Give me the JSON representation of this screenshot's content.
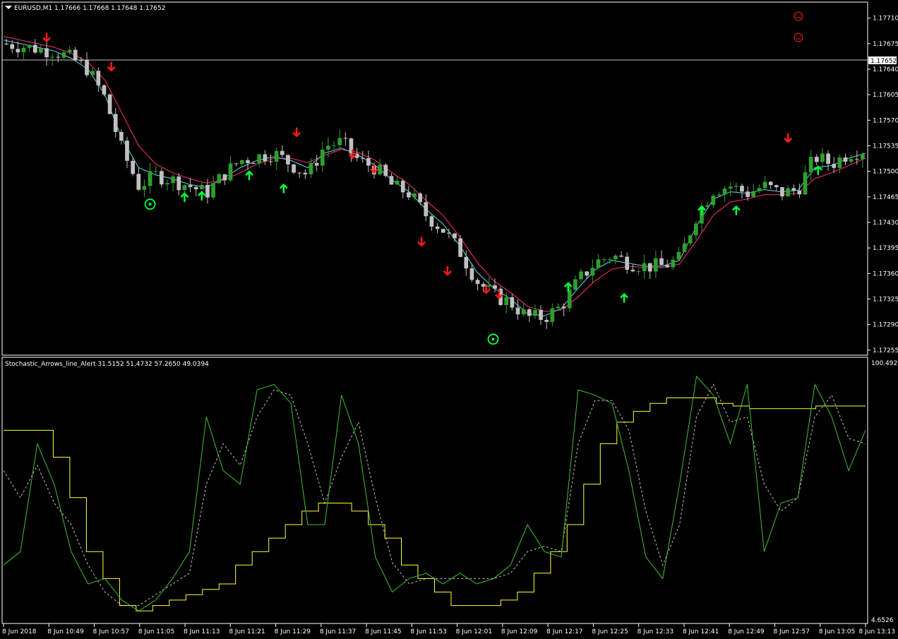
{
  "window": {
    "symbol_title": "EURUSD,M1",
    "ohlc": "1.17666 1.17668 1.17648 1.17652",
    "bid_label": "1.17652"
  },
  "indicator": {
    "title": "Stochastic_Arrows_line_Alert 31.5152 51.4732 57.2650 49.0394",
    "scale_max": "100.4927",
    "scale_min": "4.6526"
  },
  "colors": {
    "background": "#000000",
    "axis": "#ffffff",
    "bull_candle": "#2f9e2f",
    "bear_candle": "#c0c0c0",
    "ma_fast": "#5fd7e6",
    "ma_slow": "#ff2f6e",
    "buy_arrow": "#00ff3c",
    "sell_arrow": "#ff1a1a",
    "stoch_main": "#3fbf2f",
    "stoch_signal": "#c0c0c0",
    "stoch_yellow": "#ffff33",
    "face_icon": "#d42020"
  },
  "chart_data": [
    {
      "type": "candlestick",
      "title": "EURUSD,M1",
      "y_ticks": [
        "1.17710",
        "1.17675",
        "1.17640",
        "1.17605",
        "1.17570",
        "1.17535",
        "1.17500",
        "1.17465",
        "1.17430",
        "1.17395",
        "1.17360",
        "1.17325",
        "1.17290",
        "1.17255"
      ],
      "ylim": [
        1.1725,
        1.1773
      ],
      "bid_price": 1.17652,
      "x_ticks": [
        "8 Jun 2018",
        "8 Jun 10:49",
        "8 Jun 10:57",
        "8 Jun 11:05",
        "8 Jun 11:13",
        "8 Jun 11:21",
        "8 Jun 11:29",
        "8 Jun 11:37",
        "8 Jun 11:45",
        "8 Jun 11:53",
        "8 Jun 12:01",
        "8 Jun 12:09",
        "8 Jun 12:17",
        "8 Jun 12:25",
        "8 Jun 12:33",
        "8 Jun 12:41",
        "8 Jun 12:49",
        "8 Jun 12:57",
        "8 Jun 13:05",
        "8 Jun 13:13"
      ],
      "close_path": [
        1.17675,
        1.17672,
        1.17668,
        1.17665,
        1.17655,
        1.1764,
        1.176,
        1.1753,
        1.1748,
        1.17495,
        1.17488,
        1.1748,
        1.1747,
        1.17495,
        1.17515,
        1.1752,
        1.17525,
        1.1751,
        1.17495,
        1.17535,
        1.1754,
        1.17515,
        1.17505,
        1.1748,
        1.1747,
        1.1744,
        1.1742,
        1.1739,
        1.1735,
        1.1733,
        1.1732,
        1.173,
        1.173,
        1.17315,
        1.1735,
        1.17375,
        1.17385,
        1.17375,
        1.1737,
        1.1737,
        1.1738,
        1.1744,
        1.17475,
        1.1748,
        1.1747,
        1.1748,
        1.1747,
        1.17475,
        1.1752,
        1.1751,
        1.17525,
        1.1753
      ],
      "ma_fast": [
        1.1768,
        1.17675,
        1.1767,
        1.17665,
        1.17655,
        1.1764,
        1.17605,
        1.17545,
        1.17505,
        1.17495,
        1.1749,
        1.17482,
        1.17478,
        1.1749,
        1.17505,
        1.17515,
        1.1752,
        1.17515,
        1.17505,
        1.17525,
        1.17532,
        1.17522,
        1.17508,
        1.17488,
        1.17472,
        1.17448,
        1.17428,
        1.17398,
        1.17362,
        1.1734,
        1.17325,
        1.17305,
        1.17302,
        1.17312,
        1.1734,
        1.17365,
        1.17378,
        1.17374,
        1.1737,
        1.1737,
        1.17378,
        1.17425,
        1.17462,
        1.17472,
        1.1747,
        1.17475,
        1.17472,
        1.17474,
        1.17505,
        1.17508,
        1.17518,
        1.17525
      ],
      "ma_slow": [
        1.17685,
        1.1768,
        1.17675,
        1.1767,
        1.17662,
        1.1765,
        1.17625,
        1.1758,
        1.17535,
        1.1751,
        1.17498,
        1.1749,
        1.17484,
        1.17488,
        1.17498,
        1.1751,
        1.17518,
        1.17518,
        1.17512,
        1.17522,
        1.1753,
        1.17526,
        1.17515,
        1.17498,
        1.17482,
        1.1746,
        1.1744,
        1.1741,
        1.17376,
        1.1735,
        1.17334,
        1.17315,
        1.17308,
        1.1731,
        1.17328,
        1.1735,
        1.17366,
        1.1737,
        1.17368,
        1.17368,
        1.17373,
        1.17405,
        1.1744,
        1.17458,
        1.17462,
        1.17468,
        1.17468,
        1.1747,
        1.1749,
        1.17498,
        1.17508,
        1.17518
      ],
      "buy_arrows": [
        {
          "x": 0.21,
          "y": 1.17458
        },
        {
          "x": 0.23,
          "y": 1.1746
        },
        {
          "x": 0.285,
          "y": 1.17488
        },
        {
          "x": 0.325,
          "y": 1.1747
        },
        {
          "x": 0.655,
          "y": 1.17335
        },
        {
          "x": 0.72,
          "y": 1.1732
        },
        {
          "x": 0.81,
          "y": 1.1744
        },
        {
          "x": 0.85,
          "y": 1.1744
        },
        {
          "x": 0.945,
          "y": 1.17495
        }
      ],
      "sell_arrows": [
        {
          "x": 0.05,
          "y": 1.1769
        },
        {
          "x": 0.125,
          "y": 1.1765
        },
        {
          "x": 0.34,
          "y": 1.1756
        },
        {
          "x": 0.405,
          "y": 1.1753
        },
        {
          "x": 0.43,
          "y": 1.1751
        },
        {
          "x": 0.485,
          "y": 1.1741
        },
        {
          "x": 0.515,
          "y": 1.1737
        },
        {
          "x": 0.56,
          "y": 1.17345
        },
        {
          "x": 0.575,
          "y": 1.17338
        },
        {
          "x": 0.91,
          "y": 1.17552
        }
      ],
      "circle_markers": [
        {
          "x": 0.17,
          "y": 1.17455
        },
        {
          "x": 0.568,
          "y": 1.1727
        }
      ]
    },
    {
      "type": "line",
      "title": "Stochastic_Arrows_line_Alert",
      "ylim": [
        4.6526,
        100.4927
      ],
      "series": [
        {
          "name": "main",
          "values": [
            25,
            30,
            70,
            55,
            30,
            18,
            20,
            12,
            8,
            12,
            20,
            30,
            80,
            60,
            55,
            90,
            92,
            85,
            40,
            40,
            88,
            70,
            28,
            15,
            20,
            22,
            18,
            22,
            18,
            20,
            25,
            40,
            30,
            28,
            90,
            88,
            85,
            60,
            28,
            20,
            55,
            95,
            88,
            70,
            92,
            30,
            48,
            50,
            92,
            80,
            60,
            75
          ]
        },
        {
          "name": "signal",
          "values": [
            60,
            50,
            62,
            48,
            40,
            25,
            15,
            10,
            10,
            14,
            18,
            22,
            55,
            70,
            62,
            80,
            90,
            88,
            70,
            48,
            65,
            78,
            50,
            26,
            18,
            20,
            20,
            20,
            20,
            20,
            22,
            30,
            32,
            30,
            70,
            86,
            86,
            75,
            45,
            25,
            40,
            80,
            92,
            78,
            80,
            55,
            45,
            50,
            80,
            88,
            72,
            70
          ]
        },
        {
          "name": "level",
          "values": [
            75,
            75,
            75,
            65,
            50,
            30,
            20,
            10,
            8,
            10,
            12,
            14,
            16,
            18,
            25,
            30,
            35,
            40,
            45,
            48,
            48,
            45,
            40,
            35,
            25,
            20,
            15,
            10,
            10,
            10,
            12,
            15,
            22,
            30,
            40,
            55,
            70,
            78,
            82,
            85,
            87,
            87,
            87,
            85,
            84,
            83,
            83,
            83,
            83,
            84,
            84,
            84
          ]
        }
      ]
    }
  ]
}
